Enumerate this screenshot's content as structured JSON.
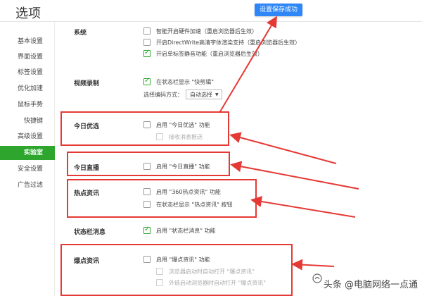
{
  "window": {
    "title": "选项"
  },
  "toast": {
    "text": "设置保存成功"
  },
  "sidebar": {
    "items": [
      {
        "label": "基本设置",
        "active": false
      },
      {
        "label": "界面设置",
        "active": false
      },
      {
        "label": "标签设置",
        "active": false
      },
      {
        "label": "优化加速",
        "active": false
      },
      {
        "label": "鼠标手势",
        "active": false
      },
      {
        "label": "快捷键",
        "active": false
      },
      {
        "label": "高级设置",
        "active": false
      },
      {
        "label": "实验室",
        "active": true
      },
      {
        "label": "安全设置",
        "active": false
      },
      {
        "label": "广告过滤",
        "active": false
      }
    ]
  },
  "sections": {
    "system": {
      "label": "系统",
      "options": [
        {
          "text": "智能开启硬件加速（重启浏览器后生效）",
          "checked": false
        },
        {
          "text": "开启DirectWrite高清字体渲染支持（重启浏览器后生效）",
          "checked": false
        },
        {
          "text": "开启单标签静音功能（重启浏览器后生效）",
          "checked": true
        }
      ]
    },
    "video": {
      "label": "视频录制",
      "option": {
        "text": "在状态栏显示 \"快剪辑\"",
        "checked": true
      },
      "encode_label": "选择编码方式：",
      "encode_value": "自动选择"
    },
    "today_pick": {
      "label": "今日优选",
      "option": {
        "text": "启用 \"今日优选\" 功能",
        "checked": false
      },
      "sub": {
        "text": "接收消息推送",
        "checked": false
      }
    },
    "today_live": {
      "label": "今日直播",
      "option": {
        "text": "启用 \"今日直播\" 功能",
        "checked": false
      }
    },
    "hot_news": {
      "label": "热点资讯",
      "options": [
        {
          "text": "启用 \"360热点资讯\" 功能",
          "checked": false
        },
        {
          "text": "在状态栏显示 \"热点资讯\" 按钮",
          "checked": false
        }
      ]
    },
    "status_msg": {
      "label": "状态栏消息",
      "option": {
        "text": "启用 \"状态栏消息\" 功能",
        "checked": true
      }
    },
    "burst_news": {
      "label": "爆点资讯",
      "option": {
        "text": "启用 \"爆点资讯\" 功能",
        "checked": false
      },
      "subs": [
        {
          "text": "浏览器启动时自动打开 \"爆点资讯\"",
          "checked": false
        },
        {
          "text": "外链启动浏览器时自动打开 \"爆点资讯\"",
          "checked": false
        }
      ]
    }
  },
  "watermark": {
    "text": "头条 @电脑网络一点通"
  },
  "colors": {
    "accent": "#2ea62e",
    "highlight": "#e53935",
    "toast": "#2f86f6"
  }
}
